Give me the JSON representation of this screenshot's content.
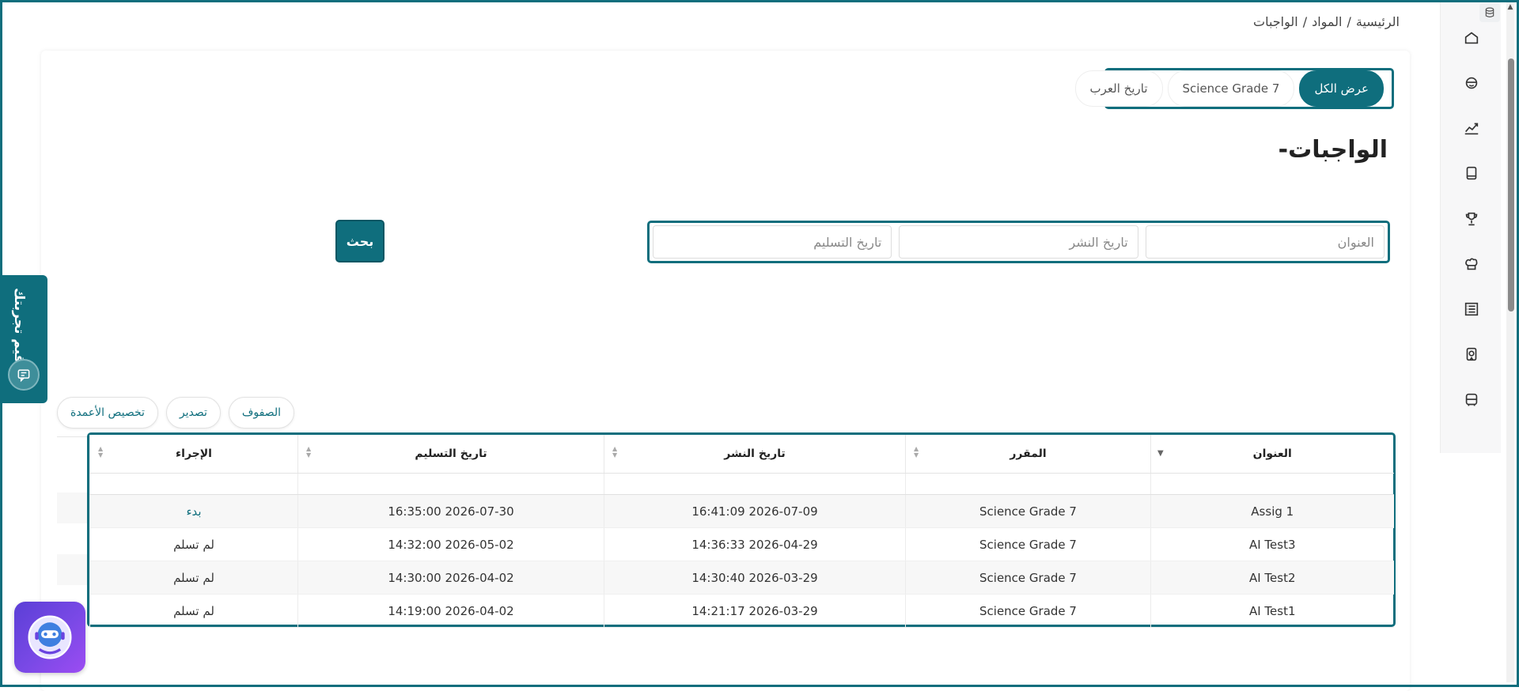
{
  "breadcrumb": {
    "home": "الرئيسية",
    "sep": "/",
    "materials": "المواد",
    "current": "الواجبات"
  },
  "tabs": [
    {
      "label": "عرض الكل",
      "active": true
    },
    {
      "label": "Science Grade 7",
      "active": false
    },
    {
      "label": "تاريخ العرب",
      "active": false
    }
  ],
  "page_title": "الواجبات-",
  "filters": {
    "title_placeholder": "العنوان",
    "publish_placeholder": "تاريخ النشر",
    "due_placeholder": "تاريخ التسليم",
    "search_label": "بحث"
  },
  "toolbar": {
    "rows_label": "الصفوف",
    "export_label": "تصدير",
    "columns_label": "تخصيص الأعمدة"
  },
  "table": {
    "headers": [
      "العنوان",
      "المقرر",
      "تاريخ النشر",
      "تاريخ التسليم",
      "الإجراء"
    ],
    "rows": [
      {
        "title": "Assig 1",
        "course": "Science Grade 7",
        "published": "2026-07-09 16:41:09",
        "due": "2026-07-30 16:35:00",
        "action": "بدء"
      },
      {
        "title": "AI Test3",
        "course": "Science Grade 7",
        "published": "2026-04-29 14:36:33",
        "due": "2026-05-02 14:32:00",
        "action": "لم تسلم"
      },
      {
        "title": "AI Test2",
        "course": "Science Grade 7",
        "published": "2026-03-29 14:30:40",
        "due": "2026-04-02 14:30:00",
        "action": "لم تسلم"
      },
      {
        "title": "AI Test1",
        "course": "Science Grade 7",
        "published": "2026-03-29 14:21:17",
        "due": "2026-04-02 14:19:00",
        "action": "لم تسلم"
      }
    ]
  },
  "feedback": {
    "label": "قيم تجربتك"
  },
  "sidebar_icons": [
    "home-icon",
    "student-icon",
    "analytics-icon",
    "book-icon",
    "trophy-icon",
    "chef-hat-icon",
    "list-icon",
    "certificate-icon",
    "bus-icon"
  ],
  "colors": {
    "accent": "#0f6e7d",
    "assistant": "#6a44e0"
  }
}
